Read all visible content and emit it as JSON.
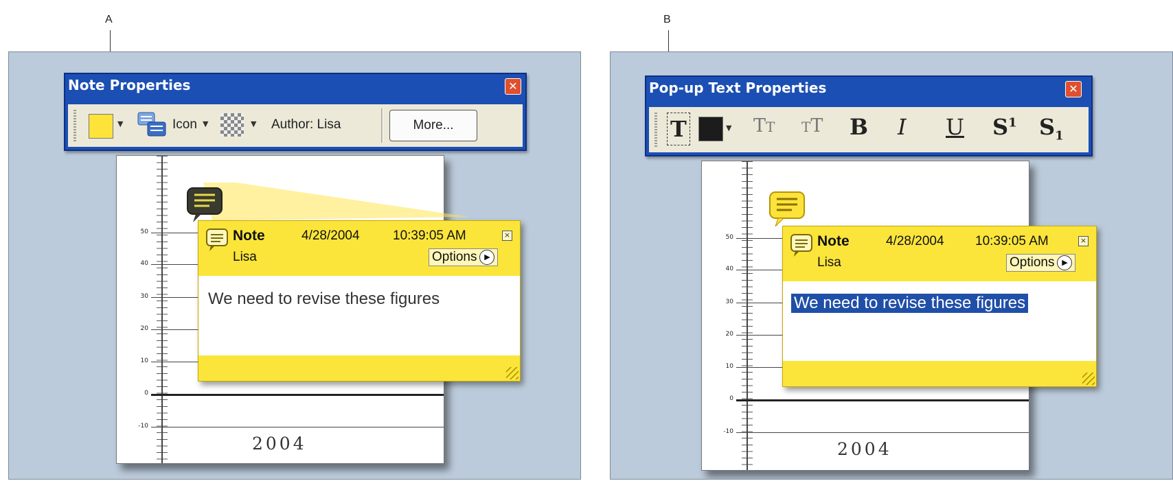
{
  "callouts": {
    "a": "A",
    "b": "B"
  },
  "chart": {
    "y_ticks": [
      "50",
      "40",
      "30",
      "20",
      "10",
      "0",
      "-10"
    ],
    "year": "2004"
  },
  "note_properties": {
    "title": "Note Properties",
    "color": "#ffe33a",
    "icon_label": "Icon",
    "author_label": "Author: Lisa",
    "more_button": "More..."
  },
  "popup_text_properties": {
    "title": "Pop-up Text Properties",
    "font_color": "#1c1c1c",
    "buttons": {
      "text": "T",
      "decrease": "TT",
      "increase": "TT",
      "bold": "B",
      "italic": "I",
      "underline": "U",
      "superscript": "S1",
      "subscript": "S1"
    }
  },
  "note_popup": {
    "title": "Note",
    "date": "4/28/2004",
    "time": "10:39:05 AM",
    "author": "Lisa",
    "options": "Options",
    "text": "We need to revise these figures"
  }
}
